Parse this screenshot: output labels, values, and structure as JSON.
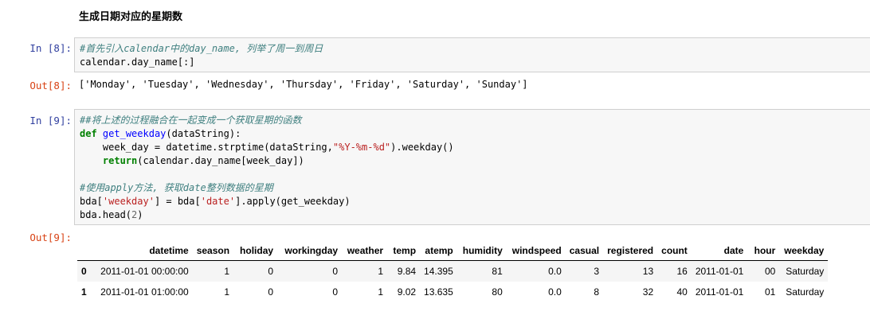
{
  "heading": "生成日期对应的星期数",
  "cells": [
    {
      "in_prompt": "In  [8]:",
      "out_prompt": "Out[8]:",
      "code_lines": [
        "#首先引入calendar中的day_name, 列举了周一到周日",
        "calendar.day_name[:]"
      ],
      "output": "['Monday', 'Tuesday', 'Wednesday', 'Thursday', 'Friday', 'Saturday', 'Sunday']"
    },
    {
      "in_prompt": "In  [9]:",
      "out_prompt": "Out[9]:",
      "code": {
        "c1": "##将上述的过程融合在一起变成一个获取星期的函数",
        "kw_def": "def",
        "fname": "get_weekday",
        "sig": "(dataString):",
        "l3a": "    week_day = datetime.strptime(dataString,",
        "l3s": "\"%Y-%m-%d\"",
        "l3b": ").weekday()",
        "kw_return": "return",
        "l4": "(calendar.day_name[week_day])",
        "c2": "#使用apply方法, 获取date整列数据的星期",
        "l6a": "bda[",
        "l6s1": "'weekday'",
        "l6b": "] = bda[",
        "l6s2": "'date'",
        "l6c": "].apply(get_weekday)",
        "l7a": "bda.head(",
        "l7n": "2",
        "l7b": ")"
      }
    }
  ],
  "table": {
    "columns": [
      "datetime",
      "season",
      "holiday",
      "workingday",
      "weather",
      "temp",
      "atemp",
      "humidity",
      "windspeed",
      "casual",
      "registered",
      "count",
      "date",
      "hour",
      "weekday"
    ],
    "rows": [
      {
        "index": "0",
        "cells": [
          "2011-01-01 00:00:00",
          "1",
          "0",
          "0",
          "1",
          "9.84",
          "14.395",
          "81",
          "0.0",
          "3",
          "13",
          "16",
          "2011-01-01",
          "00",
          "Saturday"
        ]
      },
      {
        "index": "1",
        "cells": [
          "2011-01-01 01:00:00",
          "1",
          "0",
          "0",
          "1",
          "9.02",
          "13.635",
          "80",
          "0.0",
          "8",
          "32",
          "40",
          "2011-01-01",
          "01",
          "Saturday"
        ]
      }
    ]
  }
}
